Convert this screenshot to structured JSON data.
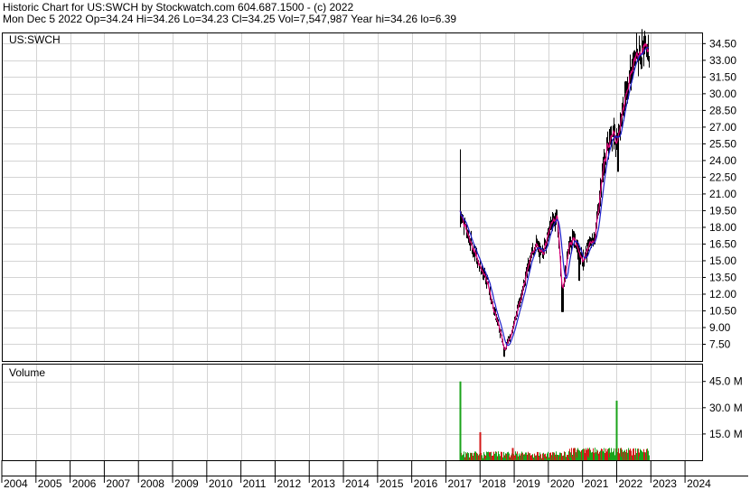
{
  "header": {
    "line1": "Historic Chart for US:SWCH by Stockwatch.com 604.687.1500 - (c) 2022",
    "line2": "Mon Dec  5 2022   Op=34.24   Hi=34.26   Lo=34.23   Cl=34.25   Vol=7,547,987   Year hi=34.26   lo=6.39"
  },
  "colors": {
    "background": "#ffffff",
    "grid": "#d4d4d4",
    "candle": "#000000",
    "ma_fast": "#e0007a",
    "ma_slow": "#1e1ecc",
    "vol_up": "#1aa31a",
    "vol_down": "#d41818"
  },
  "chart_data": [
    {
      "type": "line",
      "title": "US:SWCH",
      "ylim": [
        6.0,
        35.5
      ],
      "yticks": [
        "34.50",
        "33.00",
        "31.50",
        "30.00",
        "28.50",
        "27.00",
        "25.50",
        "24.00",
        "22.50",
        "21.00",
        "19.50",
        "18.00",
        "16.50",
        "15.00",
        "13.50",
        "12.00",
        "10.50",
        "9.00",
        "7.50"
      ],
      "grid": true,
      "x": [
        2017.42,
        2017.6,
        2017.8,
        2018.0,
        2018.2,
        2018.4,
        2018.55,
        2018.7,
        2018.85,
        2019.0,
        2019.2,
        2019.4,
        2019.6,
        2019.8,
        2020.0,
        2020.1,
        2020.25,
        2020.4,
        2020.6,
        2020.75,
        2020.9,
        2021.0,
        2021.2,
        2021.35,
        2021.5,
        2021.6,
        2021.75,
        2021.9,
        2022.0,
        2022.1,
        2022.25,
        2022.5,
        2022.7,
        2022.93
      ],
      "close": [
        19.5,
        17.5,
        16.0,
        14.5,
        13.0,
        10.5,
        9.0,
        7.0,
        8.0,
        9.5,
        12.0,
        14.5,
        16.5,
        15.5,
        17.5,
        18.5,
        19.0,
        12.0,
        16.5,
        17.0,
        15.5,
        15.0,
        16.5,
        17.0,
        21.0,
        23.5,
        25.5,
        27.0,
        25.0,
        27.5,
        30.0,
        33.0,
        34.0,
        34.25
      ],
      "year_high": 34.26,
      "year_low": 6.39
    },
    {
      "type": "bar",
      "title": "Volume",
      "ylim": [
        0,
        50
      ],
      "yticks": [
        "45.0 M",
        "30.0 M",
        "15.0 M"
      ],
      "spikes": [
        {
          "x": 2017.42,
          "value": 45.0
        },
        {
          "x": 2018.0,
          "value": 16.0
        },
        {
          "x": 2018.95,
          "value": 7.0
        },
        {
          "x": 2020.75,
          "value": 7.0
        },
        {
          "x": 2021.1,
          "value": 6.0
        },
        {
          "x": 2022.0,
          "value": 34.0
        }
      ],
      "typical_volume": 3.0
    }
  ],
  "x_axis": {
    "labels": [
      "2004",
      "2005",
      "2006",
      "2007",
      "2008",
      "2009",
      "2010",
      "2011",
      "2012",
      "2013",
      "2014",
      "2015",
      "2016",
      "2017",
      "2018",
      "2019",
      "2020",
      "2021",
      "2022",
      "2023",
      "2024"
    ],
    "start": 2004.0,
    "end": 2024.5
  }
}
